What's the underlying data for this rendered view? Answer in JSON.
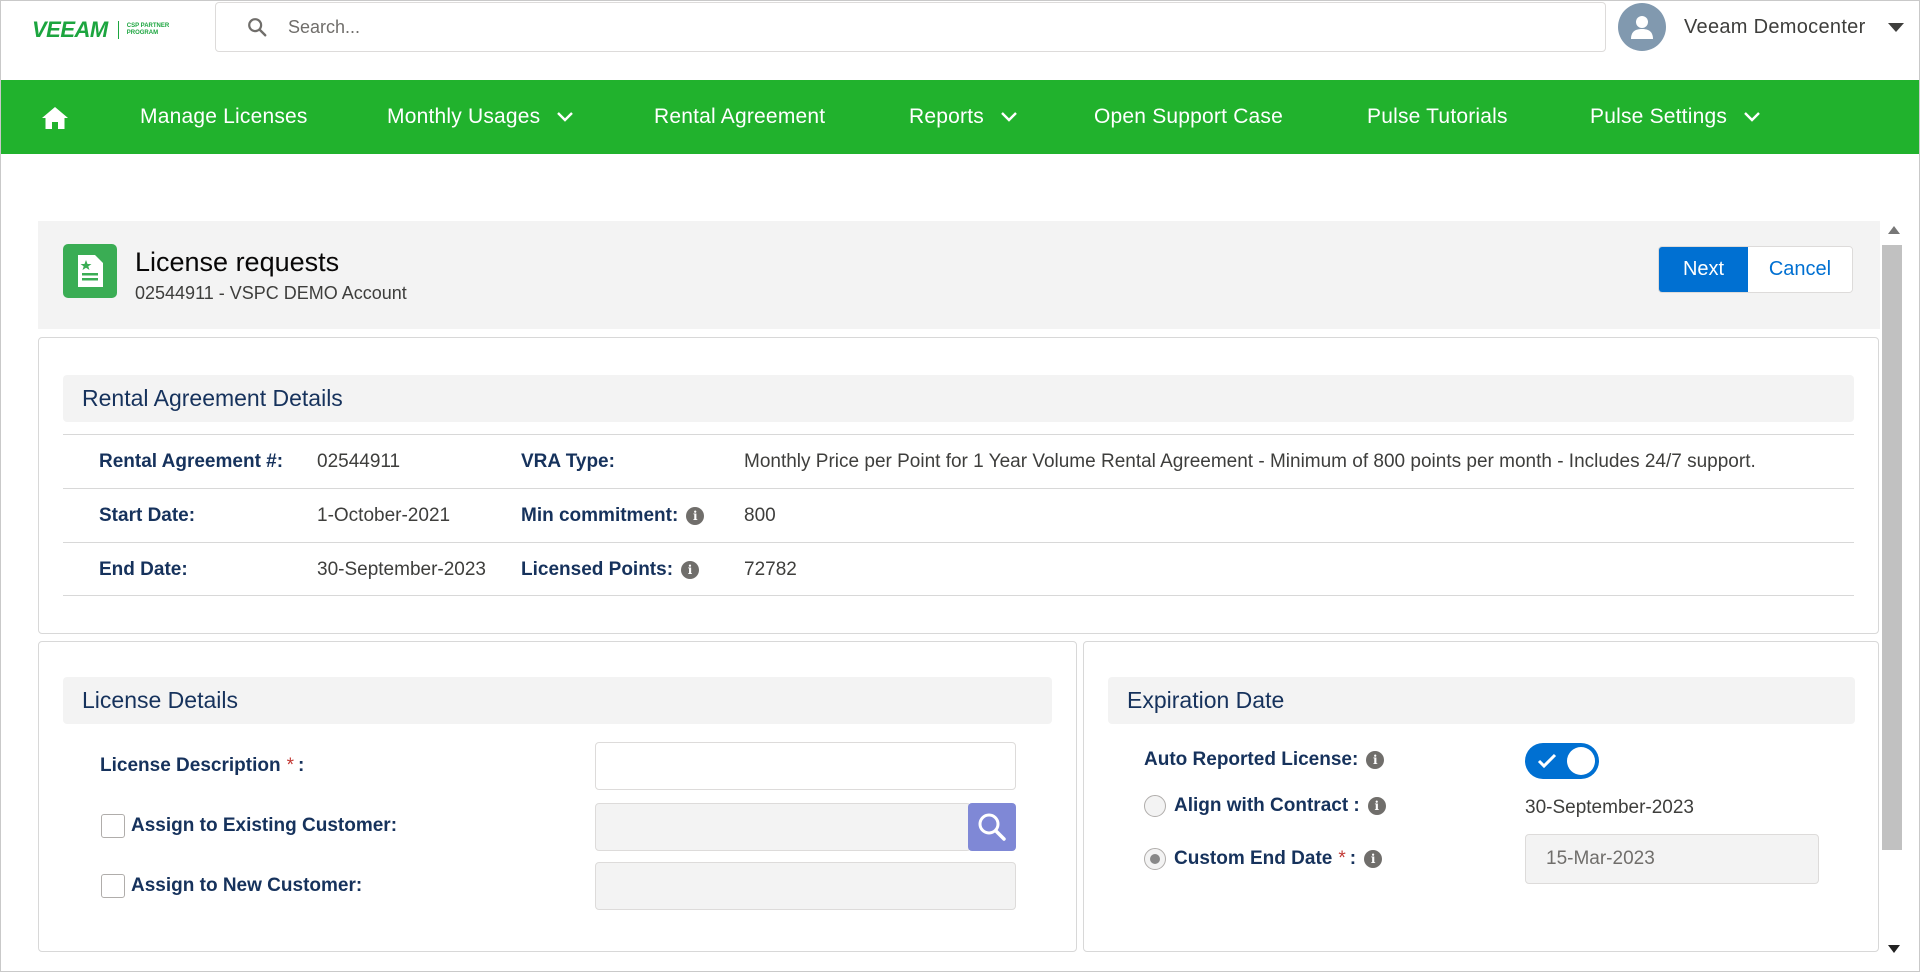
{
  "header": {
    "logo_text": "VEEAM",
    "logo_sub_1": "CSP PARTNER",
    "logo_sub_2": "PROGRAM",
    "search_placeholder": "Search...",
    "user_name": "Veeam Democenter"
  },
  "nav": {
    "items": [
      {
        "label": "Manage Licenses"
      },
      {
        "label": "Monthly Usages"
      },
      {
        "label": "Rental Agreement"
      },
      {
        "label": "Reports"
      },
      {
        "label": "Open Support Case"
      },
      {
        "label": "Pulse Tutorials"
      },
      {
        "label": "Pulse Settings"
      }
    ]
  },
  "page": {
    "title": "License requests",
    "subtitle": "02544911 - VSPC DEMO Account",
    "next_label": "Next",
    "cancel_label": "Cancel"
  },
  "rental": {
    "section_title": "Rental Agreement Details",
    "agreement_label": "Rental Agreement #:",
    "agreement_value": "02544911",
    "vra_label": "VRA Type:",
    "vra_value": "Monthly Price per Point for 1 Year Volume Rental Agreement - Minimum of 800 points per month - Includes 24/7 support.",
    "start_label": "Start Date:",
    "start_value": "1-October-2021",
    "min_label": "Min commitment:",
    "min_value": "800",
    "end_label": "End Date:",
    "end_value": "30-September-2023",
    "points_label": "Licensed Points:",
    "points_value": "72782"
  },
  "license": {
    "section_title": "License Details",
    "description_label": "License Description",
    "required_mark": "*",
    "colon": ":",
    "existing_label": "Assign to Existing Customer:",
    "new_label": "Assign to New Customer:"
  },
  "expiration": {
    "section_title": "Expiration Date",
    "auto_label": "Auto Reported License:",
    "align_label": "Align with Contract :",
    "align_value": "30-September-2023",
    "custom_label": "Custom End Date",
    "custom_value": "15-Mar-2023",
    "auto_on": true
  },
  "colors": {
    "nav_bg": "#21b22d",
    "brand_blue": "#0070d2",
    "text_navy": "#16325c"
  }
}
